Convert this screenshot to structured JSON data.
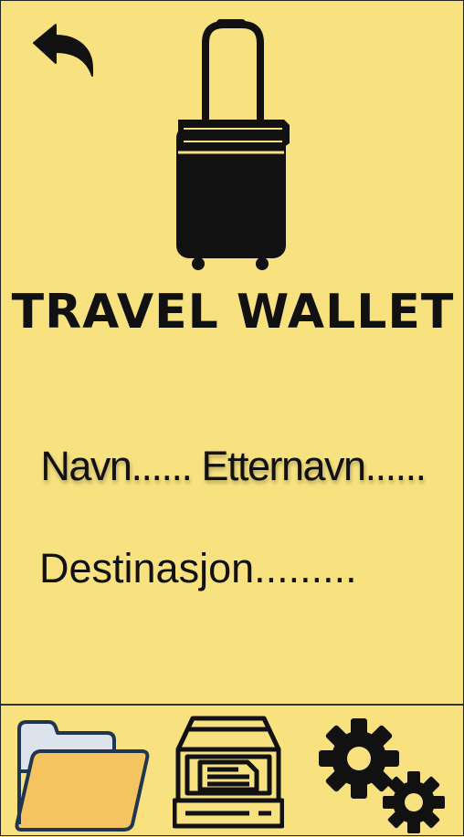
{
  "app": {
    "title": "TRAVEL WALLET"
  },
  "traveler": {
    "name_line": "Navn...... Etternavn......",
    "destination_line": "Destinasjon........."
  },
  "colors": {
    "background": "#f7e27f",
    "ink": "#111111",
    "folder_fill": "#f3c45f",
    "folder_back": "#dde3ec",
    "folder_outline": "#1f3550"
  },
  "icons": {
    "back": "back-arrow-icon",
    "logo": "suitcase-icon",
    "nav_documents": "folder-icon",
    "nav_scan": "scanner-icon",
    "nav_settings": "gears-icon"
  }
}
